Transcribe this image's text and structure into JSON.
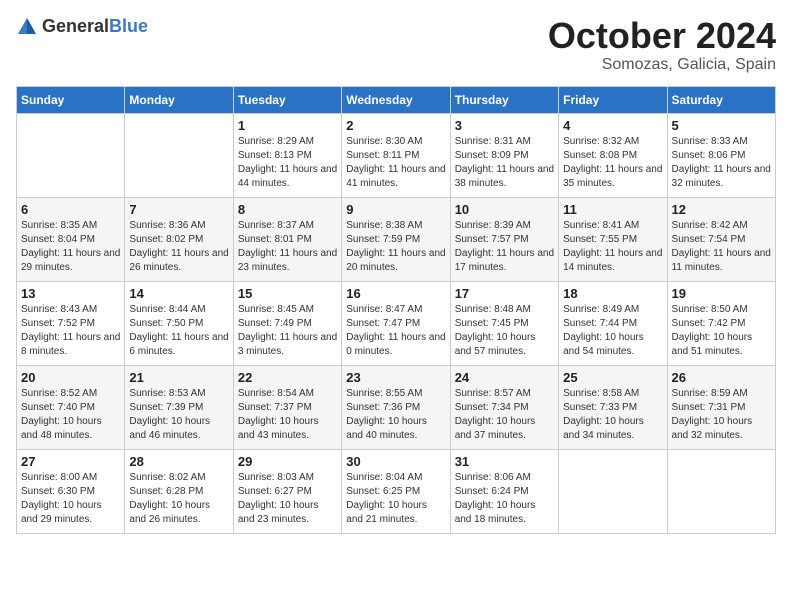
{
  "logo": {
    "text_general": "General",
    "text_blue": "Blue"
  },
  "title": "October 2024",
  "location": "Somozas, Galicia, Spain",
  "days_of_week": [
    "Sunday",
    "Monday",
    "Tuesday",
    "Wednesday",
    "Thursday",
    "Friday",
    "Saturday"
  ],
  "weeks": [
    [
      {
        "day": "",
        "sunrise": "",
        "sunset": "",
        "daylight": ""
      },
      {
        "day": "",
        "sunrise": "",
        "sunset": "",
        "daylight": ""
      },
      {
        "day": "1",
        "sunrise": "Sunrise: 8:29 AM",
        "sunset": "Sunset: 8:13 PM",
        "daylight": "Daylight: 11 hours and 44 minutes."
      },
      {
        "day": "2",
        "sunrise": "Sunrise: 8:30 AM",
        "sunset": "Sunset: 8:11 PM",
        "daylight": "Daylight: 11 hours and 41 minutes."
      },
      {
        "day": "3",
        "sunrise": "Sunrise: 8:31 AM",
        "sunset": "Sunset: 8:09 PM",
        "daylight": "Daylight: 11 hours and 38 minutes."
      },
      {
        "day": "4",
        "sunrise": "Sunrise: 8:32 AM",
        "sunset": "Sunset: 8:08 PM",
        "daylight": "Daylight: 11 hours and 35 minutes."
      },
      {
        "day": "5",
        "sunrise": "Sunrise: 8:33 AM",
        "sunset": "Sunset: 8:06 PM",
        "daylight": "Daylight: 11 hours and 32 minutes."
      }
    ],
    [
      {
        "day": "6",
        "sunrise": "Sunrise: 8:35 AM",
        "sunset": "Sunset: 8:04 PM",
        "daylight": "Daylight: 11 hours and 29 minutes."
      },
      {
        "day": "7",
        "sunrise": "Sunrise: 8:36 AM",
        "sunset": "Sunset: 8:02 PM",
        "daylight": "Daylight: 11 hours and 26 minutes."
      },
      {
        "day": "8",
        "sunrise": "Sunrise: 8:37 AM",
        "sunset": "Sunset: 8:01 PM",
        "daylight": "Daylight: 11 hours and 23 minutes."
      },
      {
        "day": "9",
        "sunrise": "Sunrise: 8:38 AM",
        "sunset": "Sunset: 7:59 PM",
        "daylight": "Daylight: 11 hours and 20 minutes."
      },
      {
        "day": "10",
        "sunrise": "Sunrise: 8:39 AM",
        "sunset": "Sunset: 7:57 PM",
        "daylight": "Daylight: 11 hours and 17 minutes."
      },
      {
        "day": "11",
        "sunrise": "Sunrise: 8:41 AM",
        "sunset": "Sunset: 7:55 PM",
        "daylight": "Daylight: 11 hours and 14 minutes."
      },
      {
        "day": "12",
        "sunrise": "Sunrise: 8:42 AM",
        "sunset": "Sunset: 7:54 PM",
        "daylight": "Daylight: 11 hours and 11 minutes."
      }
    ],
    [
      {
        "day": "13",
        "sunrise": "Sunrise: 8:43 AM",
        "sunset": "Sunset: 7:52 PM",
        "daylight": "Daylight: 11 hours and 8 minutes."
      },
      {
        "day": "14",
        "sunrise": "Sunrise: 8:44 AM",
        "sunset": "Sunset: 7:50 PM",
        "daylight": "Daylight: 11 hours and 6 minutes."
      },
      {
        "day": "15",
        "sunrise": "Sunrise: 8:45 AM",
        "sunset": "Sunset: 7:49 PM",
        "daylight": "Daylight: 11 hours and 3 minutes."
      },
      {
        "day": "16",
        "sunrise": "Sunrise: 8:47 AM",
        "sunset": "Sunset: 7:47 PM",
        "daylight": "Daylight: 11 hours and 0 minutes."
      },
      {
        "day": "17",
        "sunrise": "Sunrise: 8:48 AM",
        "sunset": "Sunset: 7:45 PM",
        "daylight": "Daylight: 10 hours and 57 minutes."
      },
      {
        "day": "18",
        "sunrise": "Sunrise: 8:49 AM",
        "sunset": "Sunset: 7:44 PM",
        "daylight": "Daylight: 10 hours and 54 minutes."
      },
      {
        "day": "19",
        "sunrise": "Sunrise: 8:50 AM",
        "sunset": "Sunset: 7:42 PM",
        "daylight": "Daylight: 10 hours and 51 minutes."
      }
    ],
    [
      {
        "day": "20",
        "sunrise": "Sunrise: 8:52 AM",
        "sunset": "Sunset: 7:40 PM",
        "daylight": "Daylight: 10 hours and 48 minutes."
      },
      {
        "day": "21",
        "sunrise": "Sunrise: 8:53 AM",
        "sunset": "Sunset: 7:39 PM",
        "daylight": "Daylight: 10 hours and 46 minutes."
      },
      {
        "day": "22",
        "sunrise": "Sunrise: 8:54 AM",
        "sunset": "Sunset: 7:37 PM",
        "daylight": "Daylight: 10 hours and 43 minutes."
      },
      {
        "day": "23",
        "sunrise": "Sunrise: 8:55 AM",
        "sunset": "Sunset: 7:36 PM",
        "daylight": "Daylight: 10 hours and 40 minutes."
      },
      {
        "day": "24",
        "sunrise": "Sunrise: 8:57 AM",
        "sunset": "Sunset: 7:34 PM",
        "daylight": "Daylight: 10 hours and 37 minutes."
      },
      {
        "day": "25",
        "sunrise": "Sunrise: 8:58 AM",
        "sunset": "Sunset: 7:33 PM",
        "daylight": "Daylight: 10 hours and 34 minutes."
      },
      {
        "day": "26",
        "sunrise": "Sunrise: 8:59 AM",
        "sunset": "Sunset: 7:31 PM",
        "daylight": "Daylight: 10 hours and 32 minutes."
      }
    ],
    [
      {
        "day": "27",
        "sunrise": "Sunrise: 8:00 AM",
        "sunset": "Sunset: 6:30 PM",
        "daylight": "Daylight: 10 hours and 29 minutes."
      },
      {
        "day": "28",
        "sunrise": "Sunrise: 8:02 AM",
        "sunset": "Sunset: 6:28 PM",
        "daylight": "Daylight: 10 hours and 26 minutes."
      },
      {
        "day": "29",
        "sunrise": "Sunrise: 8:03 AM",
        "sunset": "Sunset: 6:27 PM",
        "daylight": "Daylight: 10 hours and 23 minutes."
      },
      {
        "day": "30",
        "sunrise": "Sunrise: 8:04 AM",
        "sunset": "Sunset: 6:25 PM",
        "daylight": "Daylight: 10 hours and 21 minutes."
      },
      {
        "day": "31",
        "sunrise": "Sunrise: 8:06 AM",
        "sunset": "Sunset: 6:24 PM",
        "daylight": "Daylight: 10 hours and 18 minutes."
      },
      {
        "day": "",
        "sunrise": "",
        "sunset": "",
        "daylight": ""
      },
      {
        "day": "",
        "sunrise": "",
        "sunset": "",
        "daylight": ""
      }
    ]
  ]
}
